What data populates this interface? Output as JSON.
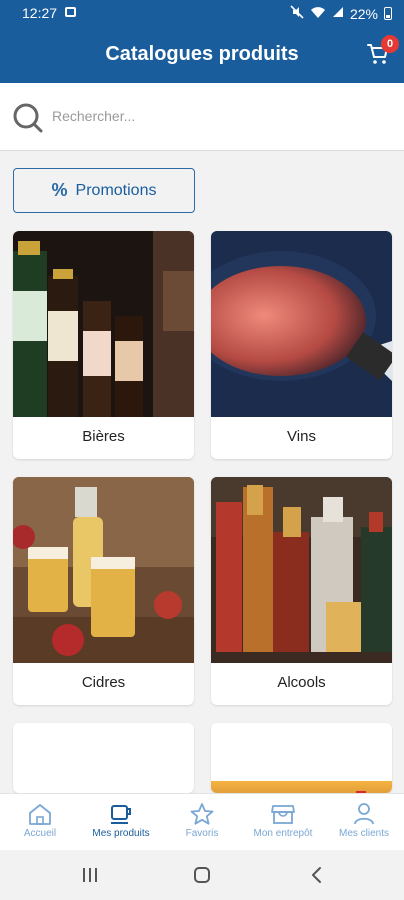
{
  "status_bar": {
    "time": "12:27",
    "battery": "22%"
  },
  "header": {
    "title": "Catalogues produits",
    "cart_count": "0"
  },
  "search": {
    "placeholder": "Rechercher..."
  },
  "promotions": {
    "label": "Promotions"
  },
  "categories": [
    {
      "label": "Bières"
    },
    {
      "label": "Vins"
    },
    {
      "label": "Cidres"
    },
    {
      "label": "Alcools"
    },
    {
      "label": ""
    },
    {
      "label": ""
    }
  ],
  "bottom_nav": [
    {
      "label": "Accueil",
      "icon": "home-icon"
    },
    {
      "label": "Mes produits",
      "icon": "coffee-cup-icon",
      "active": true
    },
    {
      "label": "Favoris",
      "icon": "star-icon"
    },
    {
      "label": "Mon entrepôt",
      "icon": "store-icon"
    },
    {
      "label": "Mes clients",
      "icon": "person-icon"
    }
  ],
  "colors": {
    "primary": "#1a5d9d",
    "nav_inactive": "#7aa7d4",
    "badge": "#e53935"
  }
}
